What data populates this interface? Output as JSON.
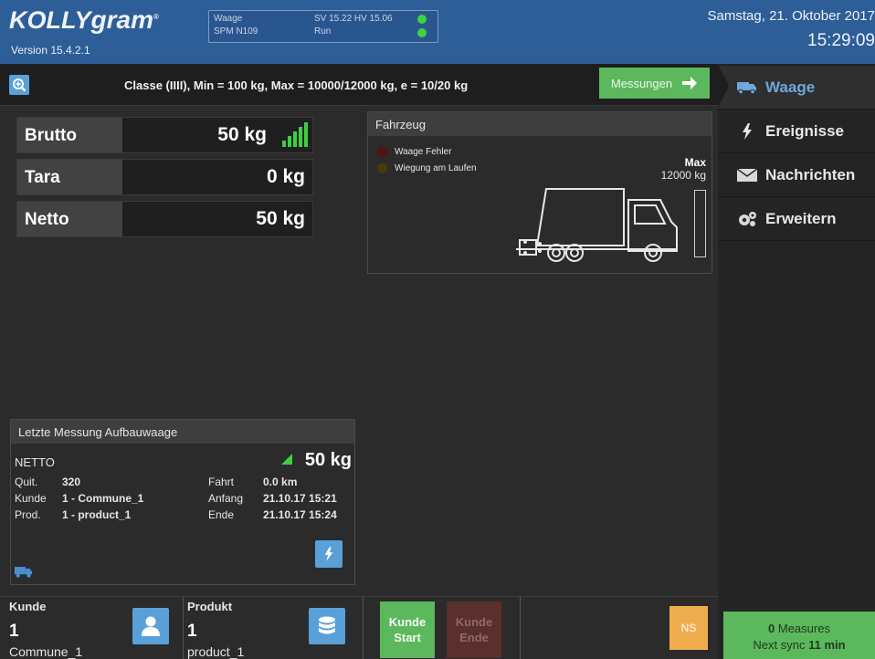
{
  "header": {
    "logo_main": "KOLLY",
    "logo_tail": "gram",
    "version": "Version 15.4.2.1",
    "waage_label": "Waage",
    "spm": "SPM N109",
    "sv_hv": "SV 15.22  HV  15.06",
    "run": "Run",
    "date": "Samstag, 21. Oktober 2017",
    "time": "15:29:09"
  },
  "subheader": {
    "class_text": "Classe (IIII), Min = 100 kg, Max = 10000/12000 kg, e = 10/20 kg",
    "messungen_label": "Messungen"
  },
  "sidebar": {
    "items": [
      {
        "label": "Waage",
        "icon": "truck-icon"
      },
      {
        "label": "Ereignisse",
        "icon": "lightning-icon"
      },
      {
        "label": "Nachrichten",
        "icon": "envelope-icon"
      },
      {
        "label": "Erweitern",
        "icon": "gears-icon"
      }
    ]
  },
  "weights": {
    "brutto_label": "Brutto",
    "brutto_value": "50 kg",
    "tara_label": "Tara",
    "tara_value": "0 kg",
    "netto_label": "Netto",
    "netto_value": "50 kg",
    "stability_bars": 5
  },
  "fahrzeug": {
    "title": "Fahrzeug",
    "led1_label": "Waage Fehler",
    "led2_label": "Wiegung am Laufen",
    "max_label": "Max",
    "max_value": "12000 kg"
  },
  "letzte": {
    "title": "Letzte Messung Aufbauwaage",
    "netto_label": "NETTO",
    "netto_value": "50 kg",
    "quit_label": "Quit.",
    "quit_value": "320",
    "kunde_label": "Kunde",
    "kunde_value": "1 - Commune_1",
    "prod_label": "Prod.",
    "prod_value": "1 - product_1",
    "fahrt_label": "Fahrt",
    "fahrt_value": "0.0 km",
    "anfang_label": "Anfang",
    "anfang_value": "21.10.17 15:21",
    "ende_label": "Ende",
    "ende_value": "21.10.17 15:24"
  },
  "bottom": {
    "kunde_header": "Kunde",
    "kunde_number": "1",
    "kunde_name": "Commune_1",
    "produkt_header": "Produkt",
    "produkt_number": "1",
    "produkt_name": "product_1",
    "kunde_start": "Kunde Start",
    "kunde_ende": "Kunde Ende",
    "ns_label": "NS",
    "measures_count": "0",
    "measures_label": " Measures",
    "sync_prefix": "Next sync ",
    "sync_value": "11 min"
  },
  "colors": {
    "header_blue": "#2d5e97",
    "accent_blue": "#5aa0d8",
    "green": "#5cb85c",
    "orange": "#f0ad4e",
    "led_red": "#5a1010",
    "led_amber": "#4a3a08"
  }
}
